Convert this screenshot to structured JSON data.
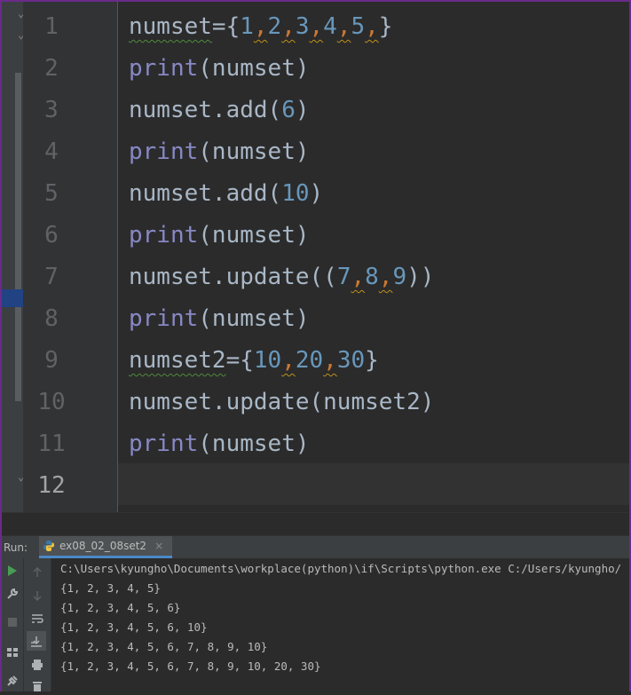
{
  "editor": {
    "lines": [
      {
        "n": "1"
      },
      {
        "n": "2"
      },
      {
        "n": "3"
      },
      {
        "n": "4"
      },
      {
        "n": "5"
      },
      {
        "n": "6"
      },
      {
        "n": "7"
      },
      {
        "n": "8"
      },
      {
        "n": "9"
      },
      {
        "n": "10"
      },
      {
        "n": "11"
      },
      {
        "n": "12"
      }
    ],
    "code": {
      "l1": {
        "name": "numset",
        "eq": "={",
        "v1": "1",
        "v2": "2",
        "v3": "3",
        "v4": "4",
        "v5": "5",
        "close": "}"
      },
      "l2": {
        "fn": "print",
        "arg": "(numset)"
      },
      "l3": {
        "pre": "numset.add(",
        "num": "6",
        "post": ")"
      },
      "l4": {
        "fn": "print",
        "arg": "(numset)"
      },
      "l5": {
        "pre": "numset.add(",
        "num": "10",
        "post": ")"
      },
      "l6": {
        "fn": "print",
        "arg": "(numset)"
      },
      "l7": {
        "pre": "numset.update((",
        "v1": "7",
        "v2": "8",
        "v3": "9",
        "post": "))"
      },
      "l8": {
        "fn": "print",
        "arg": "(numset)"
      },
      "l9": {
        "name": "numset2",
        "eq": "={",
        "v1": "10",
        "v2": "20",
        "v3": "30",
        "close": "}"
      },
      "l10": {
        "text": "numset.update(numset2)"
      },
      "l11": {
        "fn": "print",
        "arg": "(numset)"
      }
    },
    "comma": ","
  },
  "run": {
    "label": "Run:",
    "tab_name": "ex08_02_08set2",
    "close_glyph": "×",
    "output": [
      "C:\\Users\\kyungho\\Documents\\workplace(python)\\if\\Scripts\\python.exe C:/Users/kyungho/",
      "{1, 2, 3, 4, 5}",
      "{1, 2, 3, 4, 5, 6}",
      "{1, 2, 3, 4, 5, 6, 10}",
      "{1, 2, 3, 4, 5, 6, 7, 8, 9, 10}",
      "{1, 2, 3, 4, 5, 6, 7, 8, 9, 10, 20, 30}"
    ]
  },
  "icons": {
    "run": "play-icon",
    "wrench": "wrench-icon",
    "stop": "stop-icon",
    "layout": "layout-icon",
    "pin": "pin-icon",
    "up": "arrow-up-icon",
    "down": "arrow-down-icon",
    "wrap": "soft-wrap-icon",
    "scroll_end": "scroll-to-end-icon",
    "print": "print-icon",
    "trash": "trash-icon"
  },
  "colors": {
    "keyword": "#8888c6",
    "number": "#6897bb",
    "text": "#a9b7c6",
    "comma": "#cc7832"
  }
}
